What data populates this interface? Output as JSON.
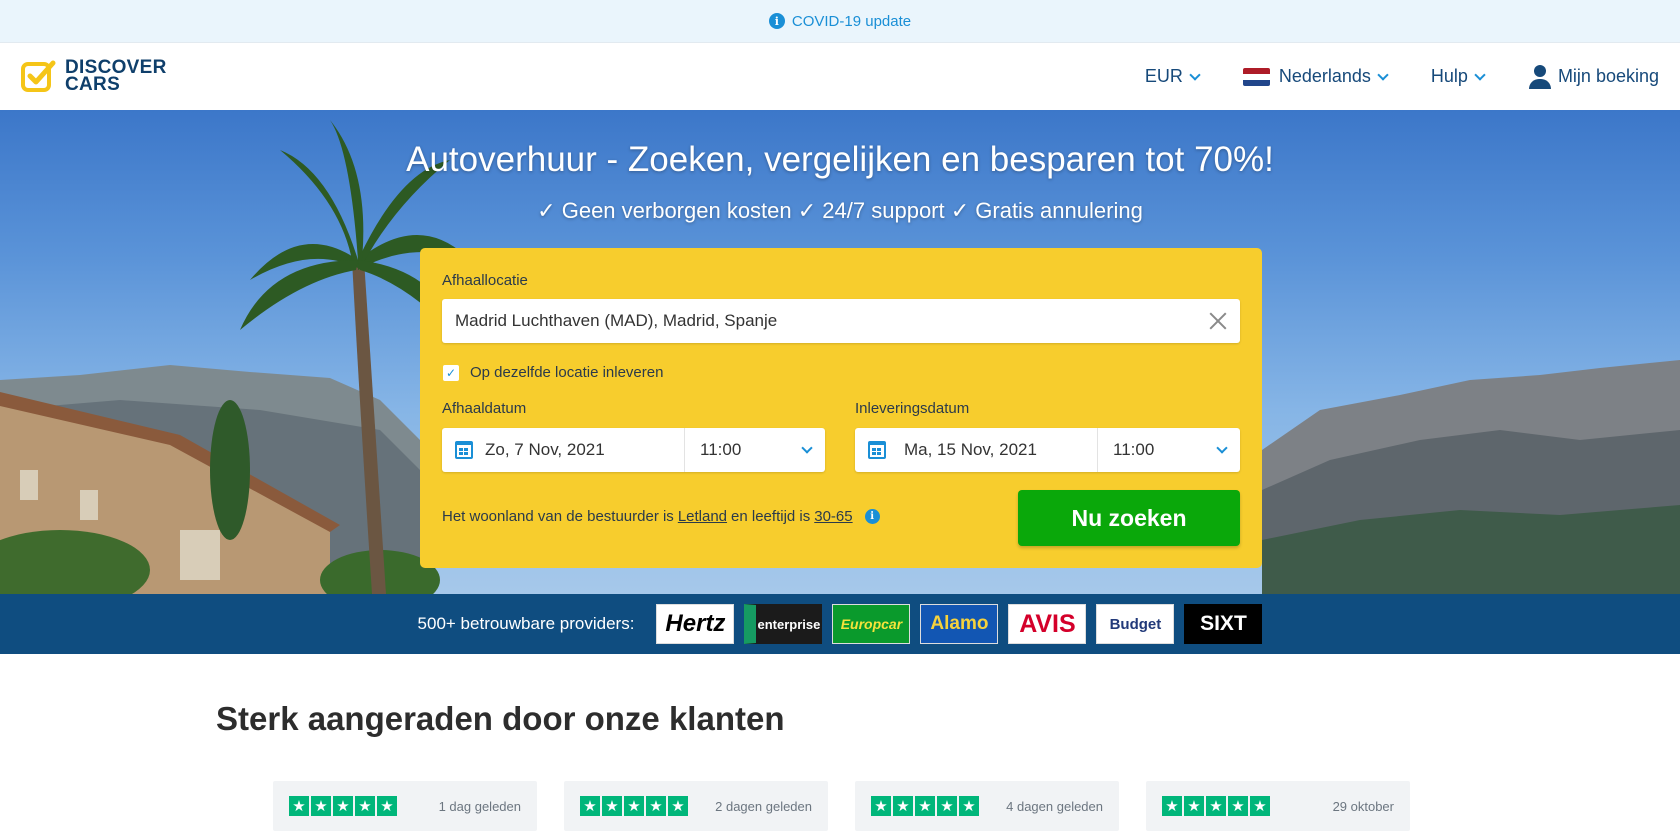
{
  "notice": {
    "text": "COVID-19 update",
    "icon": "info-icon"
  },
  "header": {
    "logo_line1": "DISCOVER",
    "logo_line2": "CARS",
    "currency": "EUR",
    "language": "Nederlands",
    "help": "Hulp",
    "booking": "Mijn boeking"
  },
  "hero": {
    "title": "Autoverhuur - Zoeken, vergelijken en besparen tot 70%!",
    "subtitle": "✓ Geen verborgen kosten ✓ 24/7 support ✓ Gratis annulering"
  },
  "search": {
    "pickup_label": "Afhaallocatie",
    "pickup_value": "Madrid Luchthaven (MAD), Madrid, Spanje",
    "same_location_label": "Op dezelfde locatie inleveren",
    "same_location_checked": true,
    "pickup_date_label": "Afhaaldatum",
    "pickup_date": "Zo, 7 Nov, 2021",
    "pickup_time": "11:00",
    "return_date_label": "Inleveringsdatum",
    "return_date": "Ma, 15 Nov, 2021",
    "return_time": "11:00",
    "driver_prefix": "Het woonland van de bestuurder is",
    "driver_country": "Letland",
    "driver_middle": "en leeftijd is",
    "driver_age": "30-65",
    "search_button": "Nu zoeken"
  },
  "providers": {
    "label": "500+ betrouwbare providers:",
    "logos": [
      "Hertz",
      "enterprise",
      "Europcar",
      "Alamo",
      "AVIS",
      "Budget",
      "SIXT"
    ]
  },
  "reviews": {
    "title": "Sterk aangeraden door onze klanten",
    "items": [
      {
        "stars": 5,
        "date": "1 dag geleden"
      },
      {
        "stars": 5,
        "date": "2 dagen geleden"
      },
      {
        "stars": 5,
        "date": "4 dagen geleden"
      },
      {
        "stars": 5,
        "date": "29 oktober"
      }
    ]
  },
  "colors": {
    "accent_blue": "#1a8fd6",
    "brand_navy": "#0f3f6b",
    "search_yellow": "#f7cd2d",
    "cta_green": "#0aa80a",
    "trustpilot_green": "#00b67a",
    "logo_yellow": "#f5c518"
  }
}
